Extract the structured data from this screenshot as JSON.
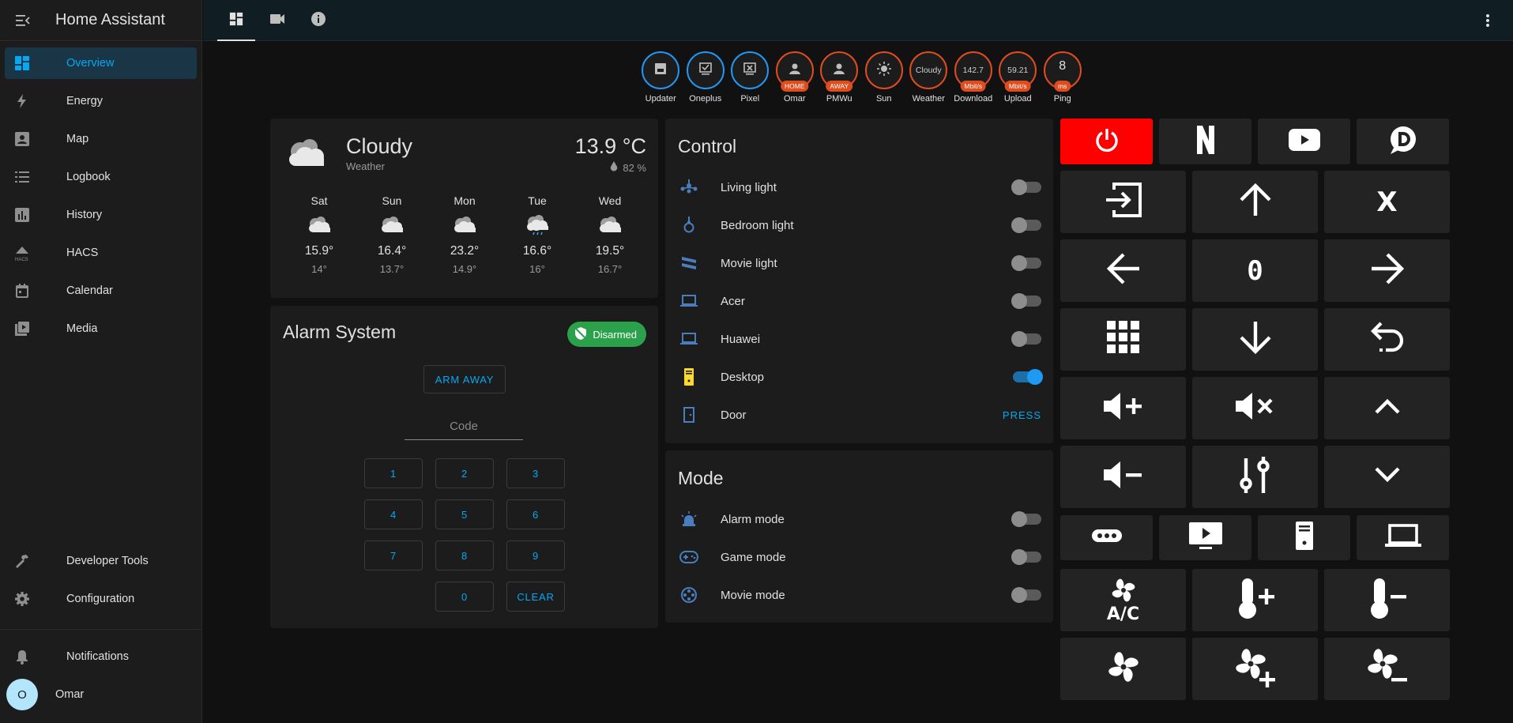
{
  "sidebar": {
    "title": "Home Assistant",
    "items": [
      {
        "label": "Overview",
        "icon": "view-dashboard-icon"
      },
      {
        "label": "Energy",
        "icon": "lightning-bolt-icon"
      },
      {
        "label": "Map",
        "icon": "account-box-icon"
      },
      {
        "label": "Logbook",
        "icon": "format-list-bulleted-icon"
      },
      {
        "label": "History",
        "icon": "chart-box-icon"
      },
      {
        "label": "HACS",
        "icon": "hacs-icon"
      },
      {
        "label": "Calendar",
        "icon": "calendar-icon"
      },
      {
        "label": "Media",
        "icon": "play-box-multiple-icon"
      }
    ],
    "developer_tools": "Developer Tools",
    "configuration": "Configuration",
    "notifications": "Notifications",
    "user": "Omar",
    "user_initial": "O"
  },
  "badges": [
    {
      "name": "Updater",
      "value": "",
      "unit": ""
    },
    {
      "name": "Oneplus",
      "value": "",
      "unit": ""
    },
    {
      "name": "Pixel",
      "value": "",
      "unit": ""
    },
    {
      "name": "Omar",
      "value": "",
      "unit": "HOME"
    },
    {
      "name": "PMWu",
      "value": "",
      "unit": "AWAY"
    },
    {
      "name": "Sun",
      "value": "",
      "unit": ""
    },
    {
      "name": "Weather",
      "value": "Cloudy",
      "unit": ""
    },
    {
      "name": "Download",
      "value": "142.7",
      "unit": "Mbit/s"
    },
    {
      "name": "Upload",
      "value": "59.21",
      "unit": "Mbit/s"
    },
    {
      "name": "Ping",
      "value": "8",
      "unit": "ms"
    }
  ],
  "weather": {
    "condition": "Cloudy",
    "subtitle": "Weather",
    "temperature": "13.9 °C",
    "humidity": "82 %",
    "forecast": [
      {
        "day": "Sat",
        "high": "15.9°",
        "low": "14°",
        "icon": "cloudy-icon"
      },
      {
        "day": "Sun",
        "high": "16.4°",
        "low": "13.7°",
        "icon": "cloudy-icon"
      },
      {
        "day": "Mon",
        "high": "23.2°",
        "low": "14.9°",
        "icon": "cloudy-icon"
      },
      {
        "day": "Tue",
        "high": "16.6°",
        "low": "16°",
        "icon": "rainy-icon"
      },
      {
        "day": "Wed",
        "high": "19.5°",
        "low": "16.7°",
        "icon": "cloudy-icon"
      }
    ]
  },
  "alarm": {
    "title": "Alarm System",
    "state": "Disarmed",
    "arm_away": "ARM AWAY",
    "code_placeholder": "Code",
    "keys": [
      "1",
      "2",
      "3",
      "4",
      "5",
      "6",
      "7",
      "8",
      "9",
      "0"
    ],
    "clear": "CLEAR"
  },
  "control": {
    "title": "Control",
    "rows": [
      {
        "label": "Living light",
        "icon": "ceiling-light-icon",
        "on": false
      },
      {
        "label": "Bedroom light",
        "icon": "lamp-icon",
        "on": false
      },
      {
        "label": "Movie light",
        "icon": "led-strip-icon",
        "on": false
      },
      {
        "label": "Acer",
        "icon": "laptop-icon",
        "on": false
      },
      {
        "label": "Huawei",
        "icon": "laptop-icon",
        "on": false
      },
      {
        "label": "Desktop",
        "icon": "desktop-tower-icon",
        "on": true
      },
      {
        "label": "Door",
        "icon": "door-icon",
        "action": "PRESS"
      }
    ]
  },
  "mode": {
    "title": "Mode",
    "rows": [
      {
        "label": "Alarm mode",
        "icon": "alarm-light-icon",
        "on": false
      },
      {
        "label": "Game mode",
        "icon": "gamepad-icon",
        "on": false
      },
      {
        "label": "Movie mode",
        "icon": "film-reel-icon",
        "on": false
      }
    ]
  },
  "remote": {
    "colors": {
      "power": "#ff0000"
    },
    "zero_label": "0",
    "x_label": "X",
    "ac_label": "A/C"
  }
}
